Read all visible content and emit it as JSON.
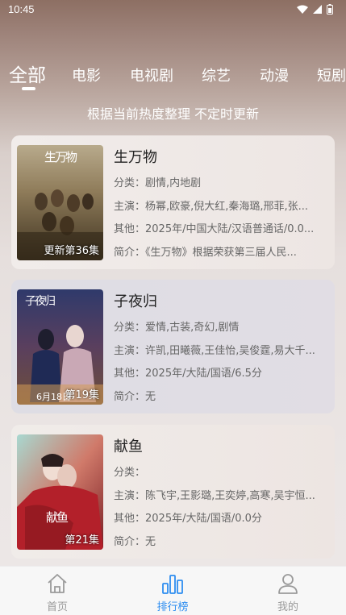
{
  "status_bar": {
    "time": "10:45"
  },
  "tabs": [
    {
      "label": "全部",
      "active": true
    },
    {
      "label": "电影"
    },
    {
      "label": "电视剧"
    },
    {
      "label": "综艺"
    },
    {
      "label": "动漫"
    },
    {
      "label": "短剧"
    }
  ],
  "subtitle": "根据当前热度整理 不定时更新",
  "items": [
    {
      "title": "生万物",
      "badge": "更新第36集",
      "category": "分类：剧情,内地剧",
      "cast": "主演：杨幂,欧豪,倪大红,秦海璐,邢菲,张...",
      "other": "其他：2025年/中国大陆/汉语普通话/0.0...",
      "intro": "简介：《生万物》根据荣获第三届人民...",
      "poster_text": "生万物"
    },
    {
      "title": "子夜归",
      "badge": "第19集",
      "category": "分类：爱情,古装,奇幻,剧情",
      "cast": "主演：许凯,田曦薇,王佳怡,吴俊霆,易大千...",
      "other": "其他：2025年/大陆/国语/6.5分",
      "intro": "简介：无",
      "poster_text": "子夜归",
      "poster_subtext": "6月18日"
    },
    {
      "title": "献鱼",
      "badge": "第21集",
      "category": "分类：",
      "cast": "主演：陈飞宇,王影璐,王奕婷,高寒,吴宇恒...",
      "other": "其他：2025年/大陆/国语/0.0分",
      "intro": "简介：无",
      "poster_text": "献鱼"
    }
  ],
  "bottom_nav": [
    {
      "label": "首页",
      "icon": "home-icon"
    },
    {
      "label": "排行榜",
      "icon": "ranking-icon",
      "active": true
    },
    {
      "label": "我的",
      "icon": "user-icon"
    }
  ],
  "colors": {
    "accent": "#2d8df0",
    "inactive_nav": "#9a9a9a"
  }
}
